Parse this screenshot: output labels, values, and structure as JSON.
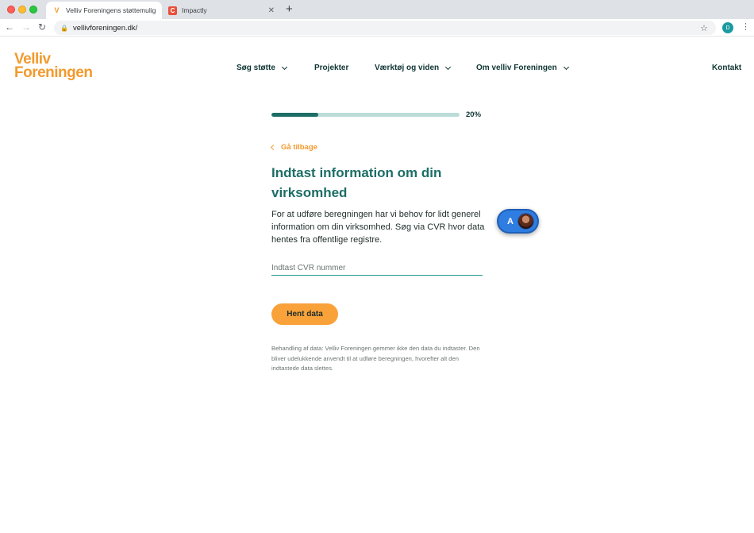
{
  "browser": {
    "tabs": [
      {
        "title": "Velliv Foreningens støttemuligh",
        "favicon": "velliv-favicon",
        "active": true
      },
      {
        "title": "Impactly",
        "favicon": "impactly-favicon",
        "active": false
      }
    ],
    "url": "vellivforeningen.dk/",
    "profile_initial": "D"
  },
  "header": {
    "logo_line1": "Velliv",
    "logo_line2": "Foreningen",
    "nav": [
      {
        "label": "Søg støtte",
        "dropdown": true
      },
      {
        "label": "Projekter",
        "dropdown": false
      },
      {
        "label": "Værktøj og viden",
        "dropdown": true
      },
      {
        "label": "Om velliv Foreningen",
        "dropdown": true
      }
    ],
    "contact": "Kontakt"
  },
  "form": {
    "progress": 0.25,
    "progress_label": "20%",
    "back_label": "Gå tilbage",
    "heading": "Indtast information om din virksomhed",
    "intro": "For at udføre beregningen har vi behov for lidt generel information om din virksomhed. Søg via CVR hvor data hentes fra offentlige registre.",
    "cvr_placeholder": "Indtast CVR nummer",
    "cvr_value": "",
    "submit_label": "Hent data",
    "disclaimer": "Behandling af data: Velliv Foreningen gemmer ikke den data du indtaster. Den bliver udelukkende anvendt til at udføre beregningen, hvorefter alt den indtastede data slettes."
  },
  "widget": {
    "letter": "A"
  },
  "colors": {
    "brand_orange": "#f29a2e",
    "button_orange": "#f9a23a",
    "teal_dark": "#1c6e66",
    "teal_light": "#bcdcd8",
    "navy_text": "#0f3533"
  }
}
